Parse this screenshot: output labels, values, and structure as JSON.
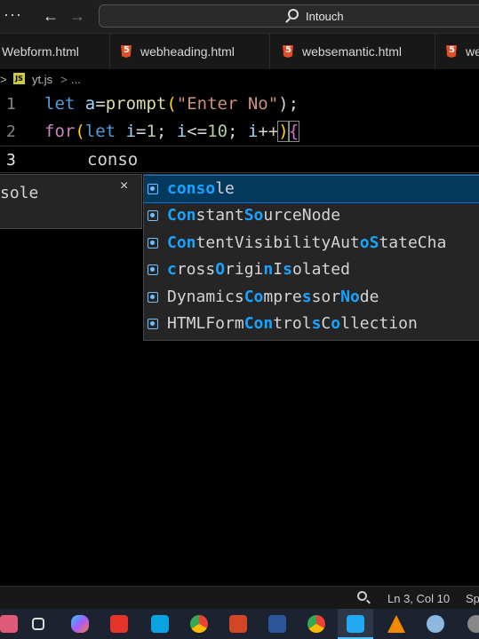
{
  "titlebar": {
    "menu_dots": "···",
    "back_arrow": "←",
    "forward_arrow": "→",
    "search_text": "Intouch"
  },
  "tabs": [
    {
      "label": "Webform.html"
    },
    {
      "label": "webheading.html"
    },
    {
      "label": "websemantic.html"
    },
    {
      "label": "we"
    }
  ],
  "breadcrumb": {
    "chevron": ">",
    "js_badge": "JS",
    "file": "yt.js",
    "separator": ">",
    "more": "..."
  },
  "editor": {
    "line_numbers": [
      "1",
      "2",
      "3"
    ],
    "line1": {
      "kw": "let",
      "var": "a",
      "eq": "=",
      "fn": "prompt",
      "open": "(",
      "str": "\"Enter No\"",
      "close": ");"
    },
    "line2": {
      "kw": "for",
      "open": "(",
      "kw2": "let",
      "a": "i",
      "b": "=",
      "c": "1",
      "d": "; ",
      "e": "i",
      "f": "<=",
      "g": "10",
      "h": "; ",
      "i": "i",
      "j": "++",
      "close": ")",
      "brace": "{"
    },
    "line3": {
      "text": "conso"
    }
  },
  "detail": {
    "text": "sole",
    "close": "×"
  },
  "suggestions": [
    {
      "parts": [
        {
          "t": "conso",
          "m": true
        },
        {
          "t": "le",
          "m": false
        }
      ]
    },
    {
      "parts": [
        {
          "t": "Con",
          "m": true
        },
        {
          "t": "stant",
          "m": false
        },
        {
          "t": "So",
          "m": true
        },
        {
          "t": "urceNode",
          "m": false
        }
      ]
    },
    {
      "parts": [
        {
          "t": "Con",
          "m": true
        },
        {
          "t": "tentVisibilityAut",
          "m": false
        },
        {
          "t": "o",
          "m": true
        },
        {
          "t": "S",
          "m": true
        },
        {
          "t": "tateCha",
          "m": false
        }
      ]
    },
    {
      "parts": [
        {
          "t": "c",
          "m": true
        },
        {
          "t": "ross",
          "m": false
        },
        {
          "t": "O",
          "m": true
        },
        {
          "t": "rigi",
          "m": false
        },
        {
          "t": "n",
          "m": true
        },
        {
          "t": "I",
          "m": false
        },
        {
          "t": "s",
          "m": true
        },
        {
          "t": "olated",
          "m": false
        }
      ]
    },
    {
      "parts": [
        {
          "t": "Dynamics",
          "m": false
        },
        {
          "t": "Co",
          "m": true
        },
        {
          "t": "mpre",
          "m": false
        },
        {
          "t": "s",
          "m": true
        },
        {
          "t": "sor",
          "m": false
        },
        {
          "t": "No",
          "m": true
        },
        {
          "t": "de",
          "m": false
        }
      ]
    },
    {
      "parts": [
        {
          "t": "HTMLForm",
          "m": false
        },
        {
          "t": "Con",
          "m": true
        },
        {
          "t": "trol",
          "m": false
        },
        {
          "t": "s",
          "m": true
        },
        {
          "t": "C",
          "m": false
        },
        {
          "t": "o",
          "m": true
        },
        {
          "t": "llection",
          "m": false
        }
      ]
    }
  ],
  "statusbar": {
    "position": "Ln 3, Col 10",
    "spaces": "Sp"
  },
  "colors": {
    "match_highlight": "#18a3ff",
    "selected_bg": "#04395e",
    "keyword": "#569cd6"
  },
  "taskbar_icons": [
    "photos-icon",
    "task-view-icon",
    "copilot-icon",
    "anydesk-icon",
    "store-icon",
    "chrome-icon",
    "powerpoint-icon",
    "word-icon",
    "chrome-icon",
    "vscode-icon",
    "vlc-icon",
    "paint-icon",
    "settings-icon"
  ]
}
